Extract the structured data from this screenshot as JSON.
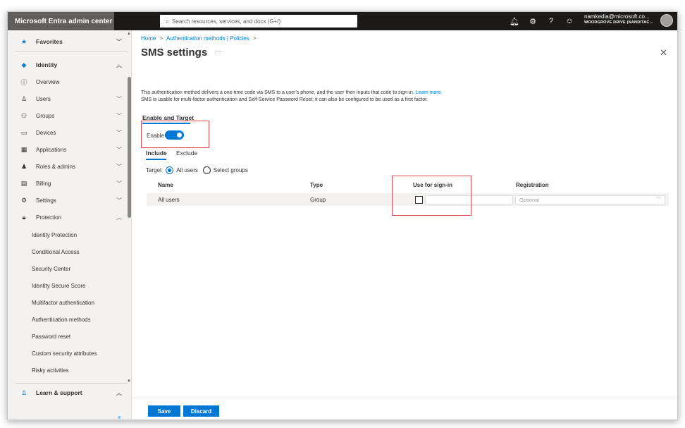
{
  "app": {
    "title": "Microsoft Entra admin center"
  },
  "search": {
    "placeholder": "Search resources, services, and docs (G+/)"
  },
  "topbar": {
    "icons": [
      "bell-icon",
      "gear-icon",
      "help-icon",
      "feedback-icon"
    ]
  },
  "account": {
    "email": "namkedia@microsoft.co...",
    "tenant": "WOODGROVE DRIVE (NANDITAC..."
  },
  "sidebar": {
    "favorites": "Favorites",
    "identity": "Identity",
    "items": [
      {
        "label": "Overview",
        "icon": "info-icon"
      },
      {
        "label": "Users",
        "icon": "user-icon"
      },
      {
        "label": "Groups",
        "icon": "groups-icon"
      },
      {
        "label": "Devices",
        "icon": "devices-icon"
      },
      {
        "label": "Applications",
        "icon": "applications-icon"
      },
      {
        "label": "Roles & admins",
        "icon": "roles-icon"
      },
      {
        "label": "Billing",
        "icon": "billing-icon"
      },
      {
        "label": "Settings",
        "icon": "settings-icon"
      },
      {
        "label": "Protection",
        "icon": "lock-icon"
      }
    ],
    "protection_items": [
      "Identity Protection",
      "Conditional Access",
      "Security Center",
      "Identity Secure Score",
      "Multifactor authentication",
      "Authentication methods",
      "Password reset",
      "Custom security attributes",
      "Risky activities"
    ],
    "learn": "Learn & support",
    "collapse": "«"
  },
  "breadcrumb": {
    "home": "Home",
    "sep": ">",
    "section": "Authentication methods | Policies"
  },
  "page": {
    "title": "SMS settings",
    "more": "···",
    "description_1": "This authentication method delivers a one-time code via SMS to a user's phone, and the user then inputs that code to sign-in.",
    "learn_more": "Learn more.",
    "description_2": "SMS is usable for multi-factor authentication and Self-Service Password Reset; it can also be configured to be used as a first factor."
  },
  "enable_target": {
    "tab": "Enable and Target",
    "enable_label": "Enable",
    "enabled": true
  },
  "tabs": {
    "include": "Include",
    "exclude": "Exclude"
  },
  "target": {
    "label": "Target",
    "all_users": "All users",
    "select_groups": "Select groups",
    "selected": "All users"
  },
  "table": {
    "headers": {
      "name": "Name",
      "type": "Type",
      "signin": "Use for sign-in",
      "registration": "Registration"
    },
    "rows": [
      {
        "name": "All users",
        "type": "Group",
        "use_for_signin": false,
        "registration": "Optional"
      }
    ]
  },
  "footer": {
    "save": "Save",
    "discard": "Discard"
  }
}
